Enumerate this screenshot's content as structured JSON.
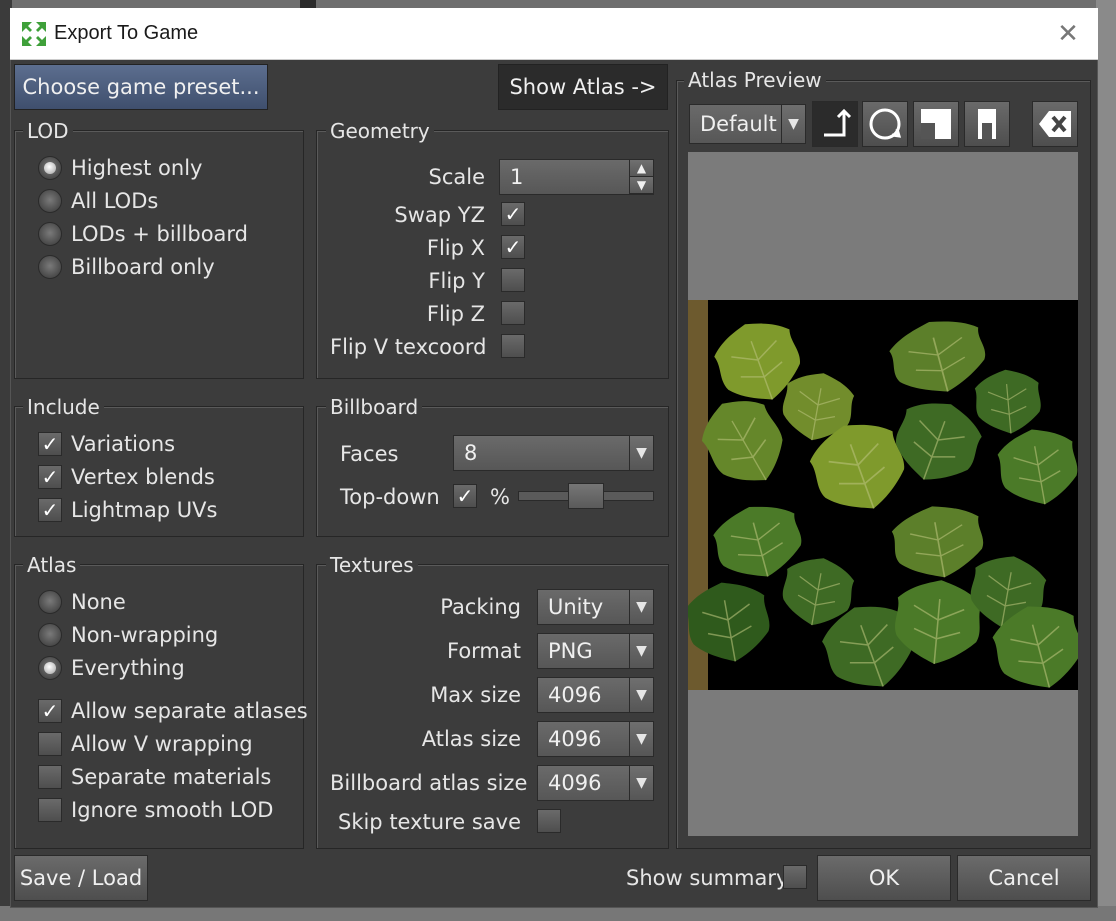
{
  "window": {
    "title": "Export To Game",
    "close_icon": "close-icon"
  },
  "top": {
    "preset_button": "Choose game preset...",
    "atlas_button": "Show Atlas ->"
  },
  "lod": {
    "title": "LOD",
    "options": [
      "Highest only",
      "All LODs",
      "LODs + billboard",
      "Billboard only"
    ],
    "selected": "Highest only"
  },
  "geometry": {
    "title": "Geometry",
    "scale_label": "Scale",
    "scale_value": "1",
    "checks": [
      {
        "label": "Swap YZ",
        "checked": true
      },
      {
        "label": "Flip X",
        "checked": true
      },
      {
        "label": "Flip Y",
        "checked": false
      },
      {
        "label": "Flip Z",
        "checked": false
      },
      {
        "label": "Flip V texcoord",
        "checked": false
      }
    ]
  },
  "include": {
    "title": "Include",
    "checks": [
      {
        "label": "Variations",
        "checked": true
      },
      {
        "label": "Vertex blends",
        "checked": true
      },
      {
        "label": "Lightmap UVs",
        "checked": true
      }
    ]
  },
  "billboard": {
    "title": "Billboard",
    "faces_label": "Faces",
    "faces_value": "8",
    "topdown_label": "Top-down",
    "topdown_checked": true,
    "percent_label": "%",
    "topdown_slider_fraction": 0.5
  },
  "atlas": {
    "title": "Atlas",
    "options": [
      "None",
      "Non-wrapping",
      "Everything"
    ],
    "selected": "Everything",
    "checks": [
      {
        "label": "Allow separate atlases",
        "checked": true
      },
      {
        "label": "Allow V wrapping",
        "checked": false
      },
      {
        "label": "Separate materials",
        "checked": false
      },
      {
        "label": "Ignore smooth LOD",
        "checked": false
      }
    ]
  },
  "textures": {
    "title": "Textures",
    "rows": [
      {
        "label": "Packing",
        "value": "Unity"
      },
      {
        "label": "Format",
        "value": "PNG"
      },
      {
        "label": "Max size",
        "value": "4096"
      },
      {
        "label": "Atlas size",
        "value": "4096"
      },
      {
        "label": "Billboard atlas size",
        "value": "4096"
      }
    ],
    "skip_label": "Skip texture save",
    "skip_checked": false
  },
  "preview": {
    "title": "Atlas Preview",
    "mode_value": "Default",
    "tools": [
      "corner-arrow-icon",
      "rotate-icon",
      "layout-square-icon",
      "layout-tall-icon",
      "clear-icon"
    ]
  },
  "footer": {
    "save_load": "Save / Load",
    "show_summary": "Show summary",
    "show_summary_checked": false,
    "ok": "OK",
    "cancel": "Cancel"
  },
  "colors": {
    "leaf_light": "#7f9a2c",
    "leaf_dark": "#3e6a24",
    "preset_blue": "#4a5a7a"
  }
}
